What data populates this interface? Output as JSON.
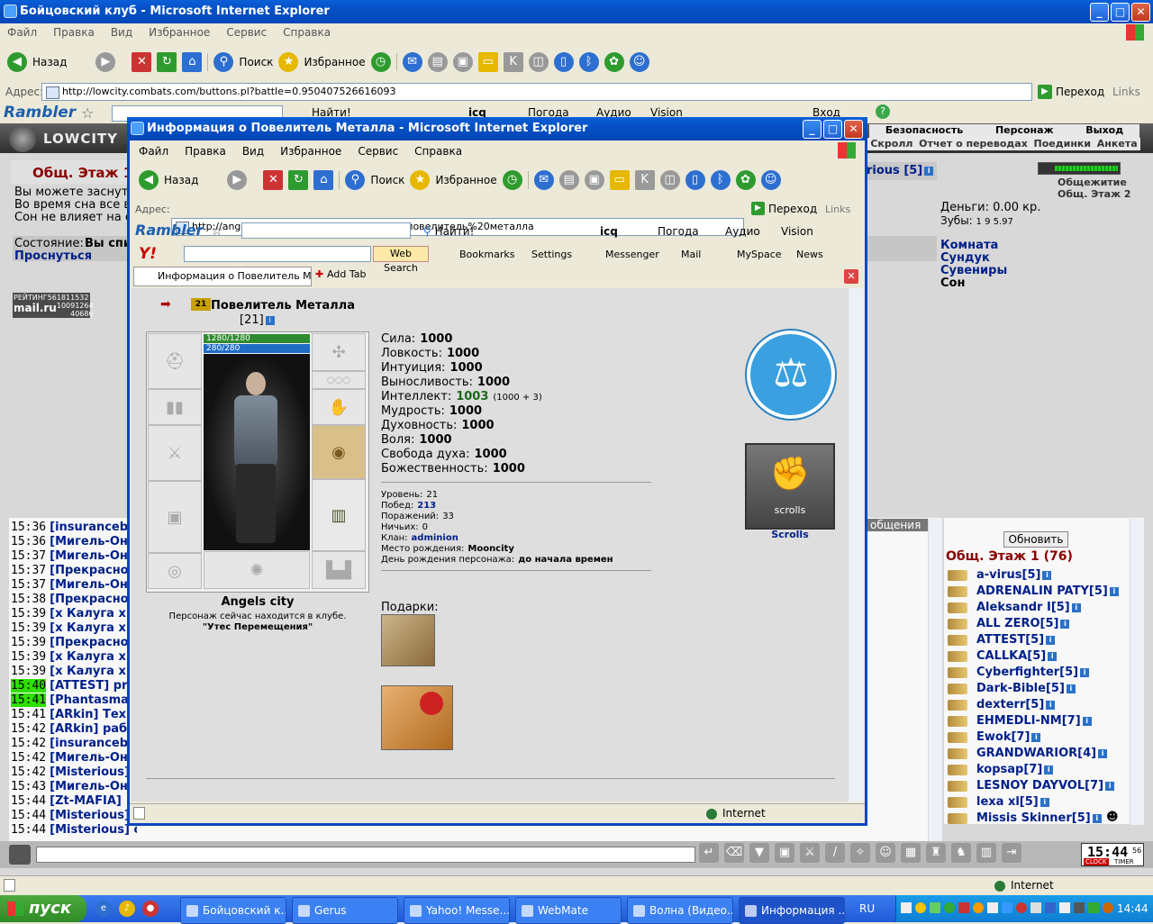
{
  "main_window": {
    "title": "Бойцовский клуб - Microsoft Internet Explorer",
    "menu": [
      "Файл",
      "Правка",
      "Вид",
      "Избранное",
      "Сервис",
      "Справка"
    ],
    "toolbar": {
      "back": "Назад",
      "search": "Поиск",
      "favorites": "Избранное"
    },
    "address_label": "Адрес:",
    "url": "http://lowcity.combats.com/buttons.pl?battle=0.950407526616093",
    "go": "Переход",
    "links": "Links",
    "rambler": "Rambler",
    "rambler_find": "Найти!",
    "rambler_icq": "icq",
    "rambler_weather": "Погода",
    "rambler_audio": "Аудио",
    "rambler_vision": "Vision",
    "rambler_login": "Вход"
  },
  "game": {
    "logo": "LOWCITY",
    "top_links": [
      "Безопасность",
      "Персонаж",
      "Выход"
    ],
    "sub_links": [
      "Скролл",
      "Отчет о переводах",
      "Поединки",
      "Анкета"
    ],
    "location_title": "Общ. Этаж 1",
    "location_text": [
      "Вы можете заснуть",
      "Во время сна все вр",
      "Сон не влияет на с"
    ],
    "state_label": "Состояние:",
    "state_value": "Вы спи",
    "wake": "Проснуться",
    "rating": "РЕЙТИНГ",
    "rating_num": "561811532",
    "mailru": "mail.ru",
    "mail_nums": [
      "10091264",
      "40686"
    ],
    "player_name": "rious [5]",
    "dorm": "Общежитие",
    "floor2": "Общ. Этаж 2",
    "money": "Деньги: 0.00 кр.",
    "teeth": "Зубы:",
    "teeth_vals": "1  9  5.97",
    "rooms": [
      "Комната",
      "Сундук",
      "Сувениры",
      "Сон"
    ],
    "messages_tab": "общения",
    "refresh": "Обновить",
    "roster_title": "Общ. Этаж 1 (76)",
    "roster": [
      "a-virus[5]",
      "ADRENALIN PATY[5]",
      "Aleksandr I[5]",
      "ALL ZERO[5]",
      "ATTEST[5]",
      "CALLKA[5]",
      "Cyberfighter[5]",
      "Dark-Bible[5]",
      "dexterr[5]",
      "EHMEDLI-NM[7]",
      "Ewok[7]",
      "GRANDWARIOR[4]",
      "kopsap[7]",
      "LESNOY DAYVOL[7]",
      "lexa xl[5]",
      "Missis Skinner[5]"
    ],
    "chat": [
      {
        "t": "15:36",
        "n": "[insuranceb"
      },
      {
        "t": "15:36",
        "n": "[Мигель-Он"
      },
      {
        "t": "15:37",
        "n": "[Мигель-Он"
      },
      {
        "t": "15:37",
        "n": "[Прекрасно"
      },
      {
        "t": "15:37",
        "n": "[Мигель-Он"
      },
      {
        "t": "15:38",
        "n": "[Прекрасно"
      },
      {
        "t": "15:39",
        "n": "[x Калуга x"
      },
      {
        "t": "15:39",
        "n": "[x Калуга x"
      },
      {
        "t": "15:39",
        "n": "[Прекрасно"
      },
      {
        "t": "15:39",
        "n": "[x Калуга x"
      },
      {
        "t": "15:39",
        "n": "[x Калуга x"
      },
      {
        "t": "15:40",
        "n": "[ATTEST] pr",
        "hl": true
      },
      {
        "t": "15:41",
        "n": "[Phantasma",
        "hl": true
      },
      {
        "t": "15:41",
        "n": "[ARkin] Тех"
      },
      {
        "t": "15:42",
        "n": "[ARkin] раб"
      },
      {
        "t": "15:42",
        "n": "[insuranceb"
      },
      {
        "t": "15:42",
        "n": "[Мигель-Он"
      },
      {
        "t": "15:42",
        "n": "[Misterious]"
      },
      {
        "t": "15:43",
        "n": "[Мигель-Он"
      },
      {
        "t": "15:44",
        "n": "[Zt-MAFIA]"
      },
      {
        "t": "15:44",
        "n": "[Misterious]"
      },
      {
        "t": "15:44",
        "n": "[Misterious] он онлине))"
      }
    ],
    "clock": "15:44",
    "clock_sec": "56",
    "clock_label": "CLOCK",
    "timer_label": "TIMER"
  },
  "popup": {
    "title": "Информация о Повелитель Металла - Microsoft Internet Explorer",
    "menu": [
      "Файл",
      "Правка",
      "Вид",
      "Избранное",
      "Сервис",
      "Справка"
    ],
    "toolbar": {
      "back": "Назад",
      "search": "Поиск",
      "favorites": "Избранное"
    },
    "address_label": "Адрес:",
    "url": "http://angelscity.combats.com/inf.pl?login=повелитель%20металла",
    "go": "Переход",
    "links": "Links",
    "rambler": "Rambler",
    "rambler_find": "Найти!",
    "rambler_icq": "icq",
    "rambler_weather": "Погода",
    "rambler_audio": "Аудио",
    "rambler_vision": "Vision",
    "yahoo": "Y!",
    "web_search": "Web Search",
    "bookmarks": "Bookmarks",
    "settings": "Settings",
    "messenger": "Messenger",
    "mail": "Mail",
    "myspace": "MySpace",
    "news": "News",
    "tab_title": "Информация о Повелитель Ме...",
    "add_tab": "Add Tab",
    "char_name": "Повелитель Металла",
    "level_tag": "[21]",
    "clan_badge": "21",
    "hp": "1280/1280",
    "mana": "280/280",
    "city": "Angels city",
    "location_line1": "Персонаж сейчас находится в клубе.",
    "location_line2": "\"Утес Перемещения\"",
    "stats": [
      {
        "k": "Сила:",
        "v": "1000"
      },
      {
        "k": "Ловкость:",
        "v": "1000"
      },
      {
        "k": "Интуиция:",
        "v": "1000"
      },
      {
        "k": "Выносливость:",
        "v": "1000"
      },
      {
        "k": "Интеллект:",
        "v": "1003",
        "extra": "(1000 + 3)"
      },
      {
        "k": "Мудрость:",
        "v": "1000"
      },
      {
        "k": "Духовность:",
        "v": "1000"
      },
      {
        "k": "Воля:",
        "v": "1000"
      },
      {
        "k": "Свобода духа:",
        "v": "1000"
      },
      {
        "k": "Божественность:",
        "v": "1000"
      }
    ],
    "details": [
      {
        "k": "Уровень:",
        "v": "21"
      },
      {
        "k": "Побед:",
        "v": "213"
      },
      {
        "k": "Поражений:",
        "v": "33"
      },
      {
        "k": "Ничьих:",
        "v": "0"
      },
      {
        "k": "Клан:",
        "v": "adminion"
      },
      {
        "k": "Место рождения:",
        "v": "Mooncity"
      },
      {
        "k": "День рождения персонажа:",
        "v": "до начала времен"
      }
    ],
    "gifts_label": "Подарки:",
    "scrolls_banner": "scrolls",
    "scrolls": "Scrolls",
    "status_zone": "Internet"
  },
  "status_zone": "Internet",
  "taskbar": {
    "start": "пуск",
    "tasks": [
      "Бойцовский к...",
      "Gerus",
      "Yahoo! Messe...",
      "WebMate",
      "Волна (Видео...",
      "Информация ..."
    ],
    "lang": "RU",
    "time": "14:44"
  }
}
